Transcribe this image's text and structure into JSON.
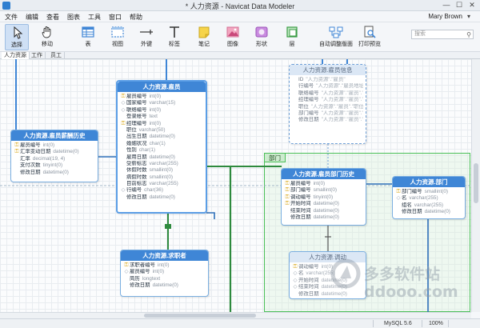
{
  "window": {
    "title": "* 人力资源 - Navicat Data Modeler"
  },
  "menu": [
    "文件",
    "编辑",
    "查看",
    "图表",
    "工具",
    "窗口",
    "帮助"
  ],
  "user": {
    "name": "Mary Brown"
  },
  "toolbar": [
    {
      "label": "选择",
      "icon": "cursor-icon"
    },
    {
      "label": "移动",
      "icon": "hand-icon"
    },
    {
      "label": "表",
      "icon": "table-icon"
    },
    {
      "label": "视图",
      "icon": "view-icon"
    },
    {
      "label": "外键",
      "icon": "foreign-key-icon"
    },
    {
      "label": "标签",
      "icon": "label-icon"
    },
    {
      "label": "笔记",
      "icon": "note-icon"
    },
    {
      "label": "图像",
      "icon": "image-icon"
    },
    {
      "label": "形状",
      "icon": "shape-icon"
    },
    {
      "label": "层",
      "icon": "layer-icon"
    },
    {
      "label": "自动调整版面",
      "icon": "auto-layout-icon"
    },
    {
      "label": "打印预览",
      "icon": "print-preview-icon"
    }
  ],
  "search": {
    "placeholder": "搜索"
  },
  "tabs": [
    "人力资源",
    "工作",
    "员工"
  ],
  "layer": {
    "label": "部门"
  },
  "tables": {
    "employee": {
      "title": "人力资源.雇员",
      "fields": [
        {
          "mark": "key",
          "name": "雇员编号",
          "type": "int(0)"
        },
        {
          "mark": "fk",
          "name": "国家编号",
          "type": "varchar(15)"
        },
        {
          "mark": "fk",
          "name": "联络编号",
          "type": "int(0)"
        },
        {
          "mark": "",
          "name": "登录帐号",
          "type": "text"
        },
        {
          "mark": "key",
          "name": "经理编号",
          "type": "int(0)"
        },
        {
          "mark": "",
          "name": "职位",
          "type": "varchar(50)"
        },
        {
          "mark": "",
          "name": "出生日期",
          "type": "datetime(0)"
        },
        {
          "mark": "",
          "name": "婚姻状况",
          "type": "char(1)"
        },
        {
          "mark": "",
          "name": "性别",
          "type": "char(1)"
        },
        {
          "mark": "",
          "name": "雇用日期",
          "type": "datetime(0)"
        },
        {
          "mark": "",
          "name": "受薪标志",
          "type": "varchar(255)"
        },
        {
          "mark": "",
          "name": "休假时数",
          "type": "smallint(0)"
        },
        {
          "mark": "",
          "name": "病假时数",
          "type": "smallint(0)"
        },
        {
          "mark": "",
          "name": "目前标志",
          "type": "varchar(255)"
        },
        {
          "mark": "fk",
          "name": "行编号",
          "type": "char(36)"
        },
        {
          "mark": "",
          "name": "修改日期",
          "type": "datetime(0)"
        }
      ]
    },
    "salary": {
      "title": "人力资源.雇员薪酬历史",
      "fields": [
        {
          "mark": "key",
          "name": "雇员编号",
          "type": "int(0)"
        },
        {
          "mark": "key",
          "name": "汇率变动日期",
          "type": "datetime(0)"
        },
        {
          "mark": "",
          "name": "汇率",
          "type": "decimal(19, 4)"
        },
        {
          "mark": "",
          "name": "支付次数",
          "type": "tinyint(0)"
        },
        {
          "mark": "",
          "name": "修改日期",
          "type": "datetime(0)"
        }
      ]
    },
    "info": {
      "title": "人力资源.雇员信息",
      "fields": [
        {
          "mark": "",
          "name": "ID",
          "type": "\"人力资源\".\"雇员\""
        },
        {
          "mark": "",
          "name": "行编号",
          "type": "\"人力资源\".\"雇员地址\""
        },
        {
          "mark": "",
          "name": "联络编号",
          "type": "\"人力资源\".\"雇员\".\"联"
        },
        {
          "mark": "",
          "name": "经理编号",
          "type": "\"人力资源\".\"雇员\".\"经"
        },
        {
          "mark": "",
          "name": "职位",
          "type": "\"人力资源\".\"雇员\".\"职位\""
        },
        {
          "mark": "",
          "name": "部门编号",
          "type": "\"人力资源\".\"雇员\".\"部"
        },
        {
          "mark": "",
          "name": "修改日期",
          "type": "\"人力资源\".\"雇员\".\"修"
        }
      ]
    },
    "candidate": {
      "title": "人力资源.求职者",
      "fields": [
        {
          "mark": "key",
          "name": "求职者编号",
          "type": "int(0)"
        },
        {
          "mark": "fk",
          "name": "雇员编号",
          "type": "int(0)"
        },
        {
          "mark": "",
          "name": "简历",
          "type": "longtext"
        },
        {
          "mark": "",
          "name": "修改日期",
          "type": "datetime(0)"
        }
      ]
    },
    "dept_history": {
      "title": "人力资源.雇员部门历史",
      "fields": [
        {
          "mark": "key",
          "name": "雇员编号",
          "type": "int(0)"
        },
        {
          "mark": "key",
          "name": "部门编号",
          "type": "smallint(0)"
        },
        {
          "mark": "key",
          "name": "调动编号",
          "type": "tinyint(0)"
        },
        {
          "mark": "key",
          "name": "开始时间",
          "type": "datetime(0)"
        },
        {
          "mark": "",
          "name": "结束时间",
          "type": "datetime(0)"
        },
        {
          "mark": "",
          "name": "修改日期",
          "type": "datetime(0)"
        }
      ]
    },
    "department": {
      "title": "人力资源.部门",
      "fields": [
        {
          "mark": "key",
          "name": "部门编号",
          "type": "smallint(0)"
        },
        {
          "mark": "fk",
          "name": "名",
          "type": "varchar(255)"
        },
        {
          "mark": "",
          "name": "组名",
          "type": "varchar(255)"
        },
        {
          "mark": "",
          "name": "修改日期",
          "type": "datetime(0)"
        }
      ]
    },
    "transfer": {
      "title": "人力资源.调动",
      "fields": [
        {
          "mark": "key",
          "name": "调动编号",
          "type": "int(0)"
        },
        {
          "mark": "fk",
          "name": "名",
          "type": "varchar(255)"
        },
        {
          "mark": "fk",
          "name": "开始时间",
          "type": "datetime(0)"
        },
        {
          "mark": "fk",
          "name": "结束时间",
          "type": "datetime(0)"
        },
        {
          "mark": "",
          "name": "修改日期",
          "type": "datetime(0)"
        }
      ]
    }
  },
  "watermark": {
    "text": "多多软件站",
    "url": "ddooo.com"
  },
  "status": {
    "db": "MySQL 5.6",
    "zoom": "100%"
  },
  "colors": {
    "header": "#3f86d6",
    "layer": "#4bbf58",
    "relation": "#2e8a3e"
  }
}
